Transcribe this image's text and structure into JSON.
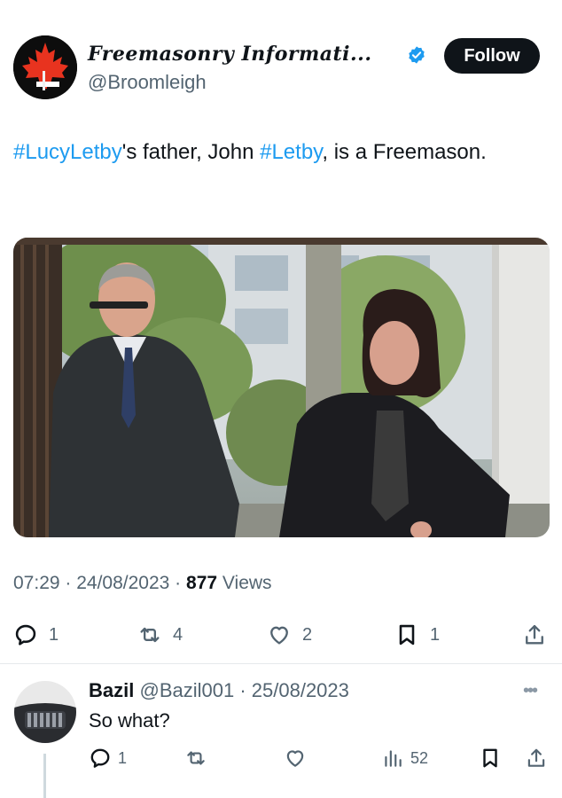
{
  "tweet": {
    "author": {
      "display_name": "Freemasonry Informati...",
      "handle": "@Broomleigh",
      "verified": true,
      "follow_label": "Follow"
    },
    "text": {
      "hashtag1": "#LucyLetby",
      "part1": "'s father, John ",
      "hashtag2": "#Letby",
      "part2": ", is a Freemason."
    },
    "meta": {
      "time": "07:29",
      "sep1": " · ",
      "date": "24/08/2023",
      "sep2": " · ",
      "views_count": "877",
      "views_label": " Views"
    },
    "actions": {
      "replies": "1",
      "retweets": "4",
      "likes": "2",
      "bookmarks": "1"
    }
  },
  "reply": {
    "name": "Bazil",
    "handle": "@Bazil001",
    "date": "· 25/08/2023",
    "text": "So what?",
    "more": "•••",
    "actions": {
      "replies": "1",
      "views": "52"
    }
  },
  "colors": {
    "hashtag": "#1d9bf0",
    "verified": "#1d9bf0",
    "secondary_text": "#536471",
    "follow_bg": "#0f1419",
    "avatar_leaf": "#e8331f"
  },
  "icons": [
    "maple-leaf-logo",
    "verified-badge-icon",
    "reply-icon",
    "retweet-icon",
    "like-icon",
    "bookmark-icon",
    "share-icon",
    "views-icon",
    "more-icon"
  ]
}
